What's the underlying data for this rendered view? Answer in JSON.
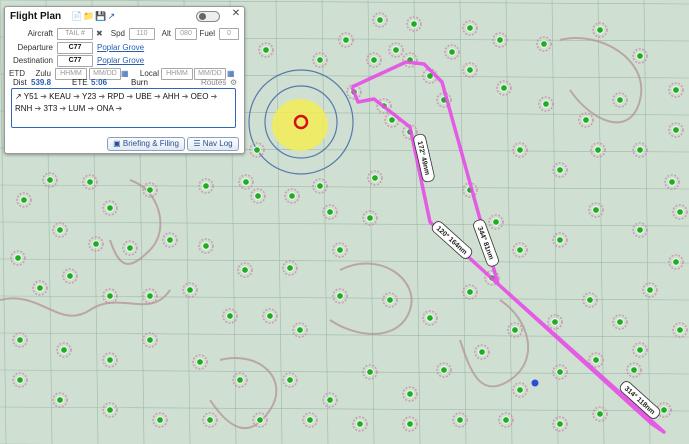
{
  "panel": {
    "title": "Flight Plan",
    "aircraft_label": "Aircraft",
    "tail_placeholder": "TAIL #",
    "spd_label": "Spd",
    "spd_placeholder": "110",
    "alt_label": "Alt",
    "alt_placeholder": "080",
    "fuel_label": "Fuel",
    "fuel_placeholder": "0",
    "departure_label": "Departure",
    "departure_value": "C77",
    "departure_name": "Poplar Grove",
    "destination_label": "Destination",
    "destination_value": "C77",
    "destination_name": "Poplar Grove",
    "etd_label": "ETD",
    "zulu_label": "Zulu",
    "time_placeholder": "HHMM",
    "date_placeholder": "MM/DD",
    "local_label": "Local",
    "dist_label": "Dist",
    "dist_value": "539.8",
    "ete_label": "ETE",
    "ete_value": "5:06",
    "burn_label": "Burn",
    "routes_label": "Routes",
    "route_waypoints": [
      "Y51",
      "KEAU",
      "Y23",
      "RPD",
      "UBE",
      "AHH",
      "OEO",
      "RNH",
      "3T3",
      "LUM",
      "ONA"
    ],
    "briefing_label": "Briefing & Filing",
    "navlog_label": "Nav Log"
  },
  "map": {
    "route_color": "#e64ce6",
    "leg_labels": [
      "172° 49nm",
      "120° 164nm",
      "344° 81nm",
      "314° 118nm"
    ]
  }
}
